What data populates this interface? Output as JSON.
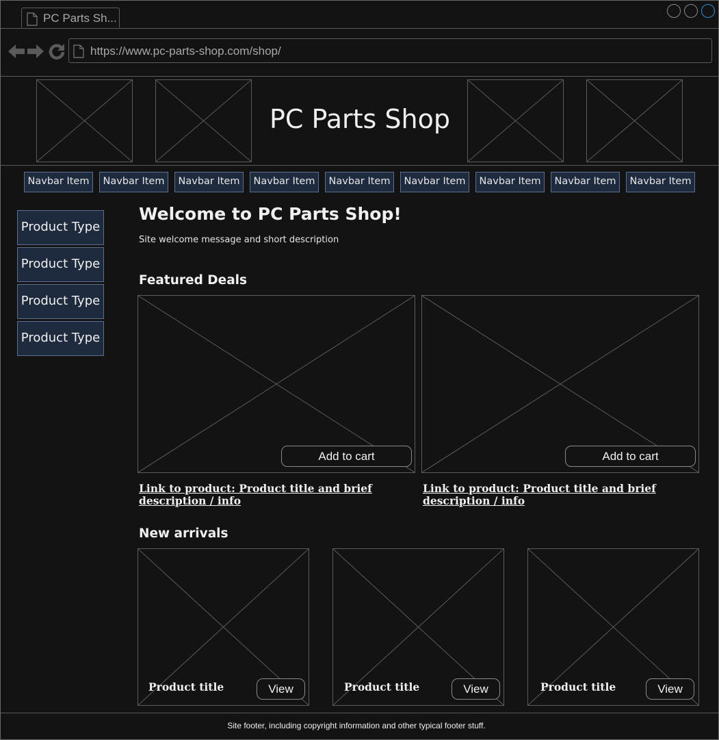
{
  "browser": {
    "tab_title": "PC Parts Sh...",
    "url": "https://www.pc-parts-shop.com/shop/",
    "icons": [
      "page-icon",
      "back-arrow-icon",
      "forward-arrow-icon",
      "reload-icon"
    ]
  },
  "header": {
    "title": "PC Parts Shop"
  },
  "navbar": {
    "items": [
      {
        "label": "Navbar Item"
      },
      {
        "label": "Navbar Item"
      },
      {
        "label": "Navbar Item"
      },
      {
        "label": "Navbar Item"
      },
      {
        "label": "Navbar Item"
      },
      {
        "label": "Navbar Item"
      },
      {
        "label": "Navbar Item"
      },
      {
        "label": "Navbar Item"
      },
      {
        "label": "Navbar Item"
      }
    ]
  },
  "sidebar": {
    "items": [
      {
        "label": "Product Type"
      },
      {
        "label": "Product Type"
      },
      {
        "label": "Product Type"
      },
      {
        "label": "Product Type"
      }
    ]
  },
  "main": {
    "welcome_heading": "Welcome to PC Parts Shop!",
    "welcome_text": "Site welcome message and short description",
    "featured": {
      "heading": "Featured Deals",
      "deals": [
        {
          "button_label": "Add to cart",
          "link_text": "Link to product: Product title and brief description / info"
        },
        {
          "button_label": "Add to cart",
          "link_text": "Link to product: Product title and brief description / info"
        }
      ]
    },
    "arrivals": {
      "heading": "New arrivals",
      "items": [
        {
          "title": "Product title",
          "button_label": "View"
        },
        {
          "title": "Product title",
          "button_label": "View"
        },
        {
          "title": "Product title",
          "button_label": "View"
        }
      ]
    }
  },
  "footer": {
    "text": "Site footer, including copyright information and other typical footer stuff."
  },
  "colors": {
    "background": "#131314",
    "border": "#5c5c5c",
    "nav_fill": "#1e2a3e",
    "nav_border": "#5d708f",
    "close_button": "#2a8fd4",
    "text": "#f0f0f0"
  }
}
